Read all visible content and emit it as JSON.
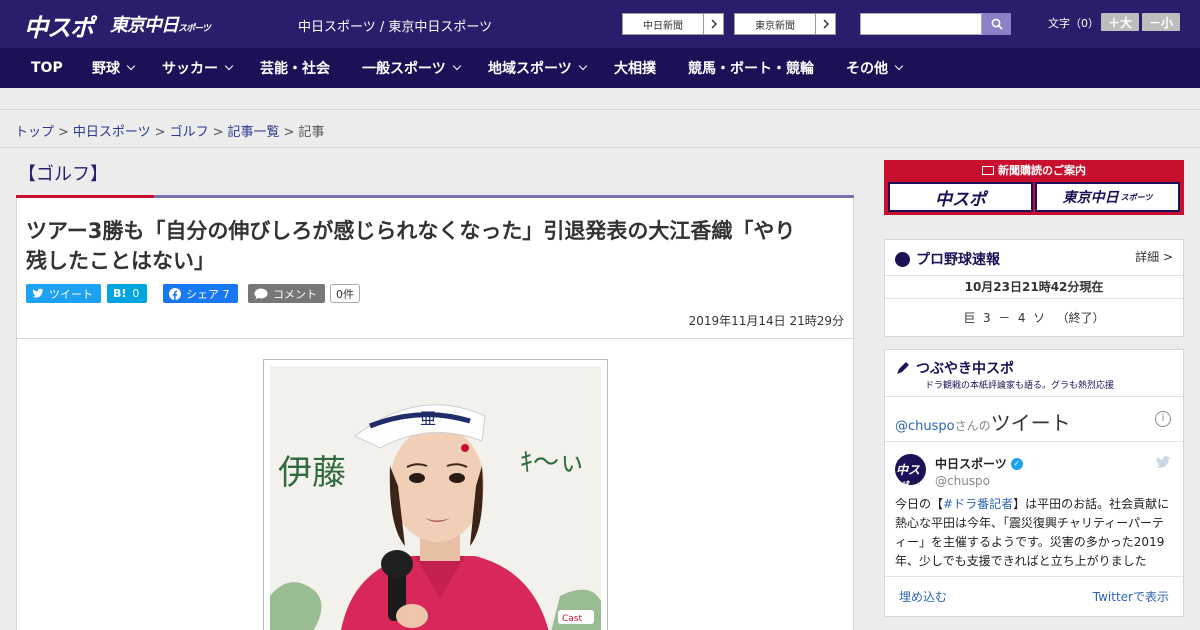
{
  "header": {
    "logo_chuspo": "中スポ",
    "logo_tokyo": "東京中日",
    "logo_tokyo_sub": "スポーツ",
    "site_links": "中日スポーツ / 東京中日スポーツ",
    "paper_buttons": [
      "中日新聞",
      "東京新聞"
    ],
    "search_placeholder": "",
    "fontsize_label": "文字（0）",
    "fontsize_plus": "＋大",
    "fontsize_minus": "－小"
  },
  "nav": {
    "items": [
      "TOP",
      "野球",
      "サッカー",
      "芸能・社会",
      "一般スポーツ",
      "地域スポーツ",
      "大相撲",
      "競馬・ボート・競輪",
      "その他"
    ]
  },
  "breadcrumb": {
    "items": [
      "トップ",
      "中日スポーツ",
      "ゴルフ",
      "記事一覧"
    ],
    "current": "記事",
    "separator": ">"
  },
  "article": {
    "category": "【ゴルフ】",
    "headline_line1": "ツアー3勝も「自分の伸びしろが感じられなくなった」引退発表の大江香織「やり",
    "headline_line2": "残したことはない」",
    "share": {
      "tweet": "ツイート",
      "hatena_icon": "B!",
      "hatena_count": "0",
      "facebook": "シェア 7",
      "comment": "コメント",
      "comment_count": "0件"
    },
    "date": "2019年11月14日 21時29分",
    "photo_sign_text": "伊藤"
  },
  "sidebar": {
    "subscription": {
      "title": "新聞購読のご案内",
      "buttons": [
        "中スポ",
        "東京中日"
      ],
      "button_sub": "スポーツ"
    },
    "baseball": {
      "title": "プロ野球速報",
      "detail": "詳細 >",
      "updated": "10月23日21時42分現在",
      "score": "巨  3  －  4  ソ   （終了）"
    },
    "tsubuyaki": {
      "title": "つぶやき中スポ",
      "subtitle": "ドラ観戦の本紙評論家も語る。グラも熱烈応援",
      "handle_link": "@chuspo",
      "handle_suffix": "さんの",
      "tweets_label": "ツイート",
      "tweet_user": "中日スポーツ",
      "tweet_handle": "@chuspo",
      "tweet_text_1": "今日の【",
      "tweet_hashtag": "#ドラ番記者",
      "tweet_text_2": "】は平田のお話。社会貢献に熱心な平田は今年、「震災復興チャリティーパーティー」を主催するようです。災害の多かった2019年、少しでも支援できればと立ち上がりました",
      "embed": "埋め込む",
      "view_on_twitter": "Twitterで表示"
    }
  },
  "colors": {
    "header_bg": "#2b1d6b",
    "nav_bg": "#1c1156",
    "accent_red": "#c8102e",
    "twitter": "#1da1f2",
    "hatena": "#00a4de",
    "facebook": "#1877f2",
    "comment_gray": "#777777"
  }
}
